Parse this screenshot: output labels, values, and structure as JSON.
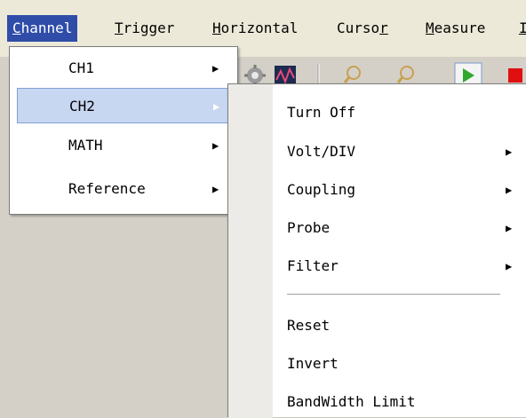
{
  "menubar": {
    "items": [
      {
        "label": "Channel",
        "accel": "C",
        "rest": "hannel"
      },
      {
        "label": "Trigger",
        "accel": "T",
        "rest": "rigger"
      },
      {
        "label": "Horizontal",
        "accel": "H",
        "rest": "orizontal"
      },
      {
        "label": "Cursor",
        "pre": "Curso",
        "accel": "r"
      },
      {
        "label": "Measure",
        "accel": "M",
        "rest": "easure"
      },
      {
        "label": "I",
        "accel": "I"
      }
    ],
    "active": "Channel"
  },
  "toolbar": {
    "icons": [
      "gear-icon",
      "waveform-icon",
      "zoom-out-icon",
      "zoom-in-icon",
      "run-icon",
      "stop-icon"
    ]
  },
  "channel_menu": {
    "items": [
      {
        "label": "CH1",
        "has_submenu": true
      },
      {
        "label": "CH2",
        "has_submenu": true,
        "highlighted": true
      },
      {
        "label": "MATH",
        "has_submenu": true
      },
      {
        "label": "Reference",
        "has_submenu": true
      }
    ]
  },
  "ch2_submenu": {
    "items": [
      {
        "label": "Turn Off",
        "has_submenu": false
      },
      {
        "label": "Volt/DIV",
        "has_submenu": true
      },
      {
        "label": "Coupling",
        "has_submenu": true
      },
      {
        "label": "Probe",
        "has_submenu": true
      },
      {
        "label": "Filter",
        "has_submenu": true
      },
      {
        "label": "Reset",
        "has_submenu": false
      },
      {
        "label": "Invert",
        "has_submenu": false
      },
      {
        "label": "BandWidth Limit",
        "has_submenu": false
      }
    ]
  },
  "colors": {
    "menubar_bg": "#ece9d8",
    "active_menu_bg": "#2f4da8",
    "highlight_bg": "#c7d6f1",
    "menu_bg": "#ffffff",
    "run_green": "#2ea82e",
    "stop_red": "#e01010"
  }
}
